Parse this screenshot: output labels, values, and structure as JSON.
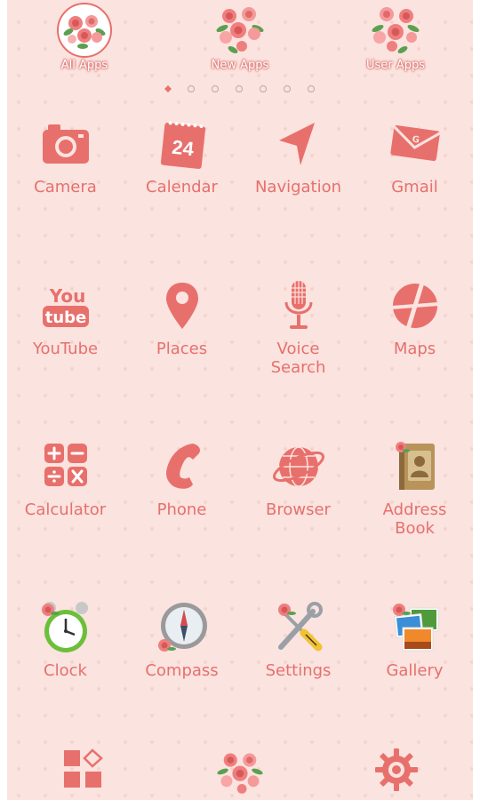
{
  "top_bar": {
    "all_apps": "All Apps",
    "new_apps": "New Apps",
    "user_apps": "User Apps"
  },
  "page_indicator": {
    "page_count": 7,
    "current_page": 1
  },
  "apps": [
    {
      "label": "Camera",
      "icon": "camera-icon"
    },
    {
      "label": "Calendar",
      "icon": "calendar-icon",
      "day": "24"
    },
    {
      "label": "Navigation",
      "icon": "navigation-icon"
    },
    {
      "label": "Gmail",
      "icon": "gmail-icon"
    },
    {
      "label": "YouTube",
      "icon": "youtube-icon",
      "logo_top": "You",
      "logo_bottom": "tube"
    },
    {
      "label": "Places",
      "icon": "places-icon"
    },
    {
      "label": "Voice\nSearch",
      "icon": "microphone-icon"
    },
    {
      "label": "Maps",
      "icon": "maps-icon"
    },
    {
      "label": "Calculator",
      "icon": "calculator-icon"
    },
    {
      "label": "Phone",
      "icon": "phone-icon"
    },
    {
      "label": "Browser",
      "icon": "globe-icon"
    },
    {
      "label": "Address\nBook",
      "icon": "address-book-icon"
    },
    {
      "label": "Clock",
      "icon": "alarm-clock-icon"
    },
    {
      "label": "Compass",
      "icon": "compass-icon"
    },
    {
      "label": "Settings",
      "icon": "tools-icon"
    },
    {
      "label": "Gallery",
      "icon": "gallery-icon"
    }
  ],
  "dock": {
    "items": [
      {
        "icon": "app-drawer-icon"
      },
      {
        "icon": "rose-bouquet-icon"
      },
      {
        "icon": "settings-gear-icon"
      }
    ]
  },
  "colors": {
    "accent": "#e8706c",
    "background": "#fbe3df",
    "label": "#e6706d"
  }
}
